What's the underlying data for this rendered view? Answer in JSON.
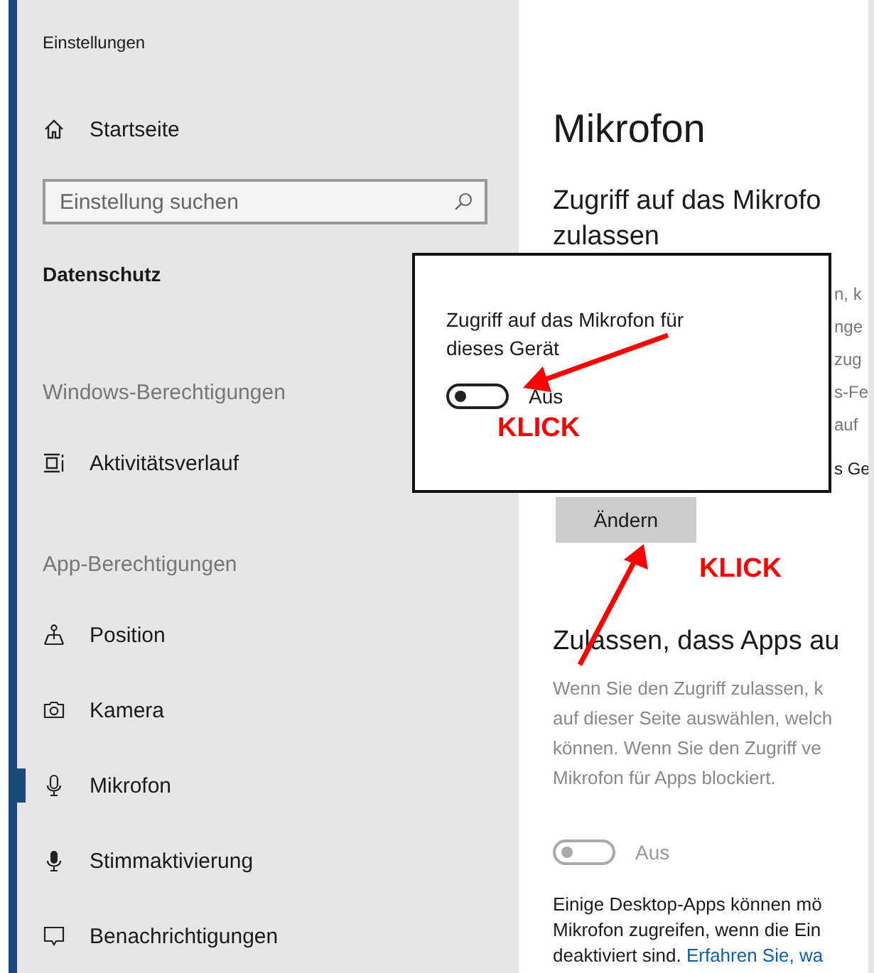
{
  "window": {
    "title": "Einstellungen"
  },
  "sidebar": {
    "home": "Startseite",
    "search": {
      "placeholder": "Einstellung suchen"
    },
    "category": "Datenschutz",
    "sections": [
      {
        "heading": "Windows-Berechtigungen",
        "items": [
          {
            "label": "Aktivitätsverlauf",
            "kind": "timeline",
            "selected": false
          }
        ]
      },
      {
        "heading": "App-Berechtigungen",
        "items": [
          {
            "label": "Position",
            "kind": "location",
            "selected": false
          },
          {
            "label": "Kamera",
            "kind": "camera",
            "selected": false
          },
          {
            "label": "Mikrofon",
            "kind": "microphone",
            "selected": true
          },
          {
            "label": "Stimmaktivierung",
            "kind": "voice",
            "selected": false
          },
          {
            "label": "Benachrichtigungen",
            "kind": "notification",
            "selected": false
          }
        ]
      }
    ]
  },
  "page": {
    "title": "Mikrofon",
    "heading_1": [
      "Zugriff auf das Mikrofo",
      "zulassen"
    ],
    "covered_lines": [
      "n, k",
      "nge",
      "zug",
      "s-Fe",
      "auf"
    ],
    "covered_line_2": "s Ge",
    "change_button": "Ändern",
    "heading_2": "Zulassen, dass Apps au",
    "paragraph": [
      "Wenn Sie den Zugriff zulassen, k",
      "auf dieser Seite auswählen, welch",
      "können. Wenn Sie den Zugriff ve",
      "Mikrofon für Apps blockiert."
    ],
    "toggle": {
      "on": false,
      "disabled": true,
      "label": "Aus"
    },
    "note": [
      "Einige Desktop-Apps können mö",
      "Mikrofon zugreifen, wenn die Ein"
    ],
    "note_last": "deaktiviert sind.",
    "note_link": "Erfahren Sie, wa"
  },
  "dialog": {
    "text": "Zugriff auf das Mikrofon für dieses Gerät",
    "toggle": {
      "on": false,
      "disabled": false,
      "label": "Aus"
    }
  },
  "annotations": [
    {
      "text": "KLICK"
    },
    {
      "text": "KLICK"
    }
  ]
}
